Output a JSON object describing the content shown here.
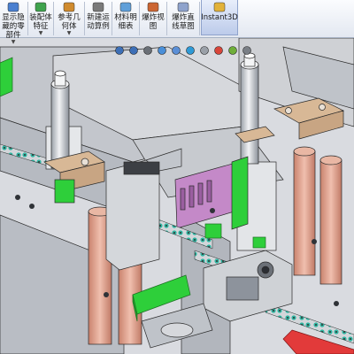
{
  "ribbon": {
    "buttons": [
      {
        "label_lines": [
          "显示隐",
          "藏的零",
          "部件"
        ],
        "icon": "show-hidden-components-icon",
        "dropdown": true
      },
      {
        "label_lines": [
          "装配体",
          "特征"
        ],
        "icon": "assembly-features-icon",
        "dropdown": true
      },
      {
        "label_lines": [
          "参考几",
          "何体"
        ],
        "icon": "reference-geometry-icon",
        "dropdown": true
      },
      {
        "label_lines": [
          "新建运",
          "动算例"
        ],
        "icon": "new-motion-study-icon",
        "dropdown": false
      },
      {
        "label_lines": [
          "材料明",
          "细表"
        ],
        "icon": "bill-of-materials-icon",
        "dropdown": false
      },
      {
        "label_lines": [
          "爆炸视",
          "图"
        ],
        "icon": "exploded-view-icon",
        "dropdown": false
      },
      {
        "label_lines": [
          "爆炸直",
          "线草图"
        ],
        "icon": "explode-line-sketch-icon",
        "dropdown": false
      },
      {
        "label_lines": [
          "Instant3D"
        ],
        "icon": "instant3d-icon",
        "dropdown": false,
        "active": true
      }
    ]
  },
  "heads_up_toolbar": {
    "icons": [
      "zoom-to-fit-icon",
      "zoom-to-area-icon",
      "previous-view-icon",
      "section-view-icon",
      "view-orientation-icon",
      "display-style-icon",
      "hide-show-items-icon",
      "edit-appearance-icon",
      "apply-scene-icon",
      "view-settings-icon"
    ]
  },
  "colors": {
    "background": "#d9dbe0",
    "part_gray": "#c9cdd4",
    "part_dark": "#8d939c",
    "green": "#2ecf3a",
    "copper": "#e2a68e",
    "tan": "#d8b896",
    "purple": "#c489c8",
    "red": "#e23a3a",
    "teal": "#2fb6a2"
  }
}
